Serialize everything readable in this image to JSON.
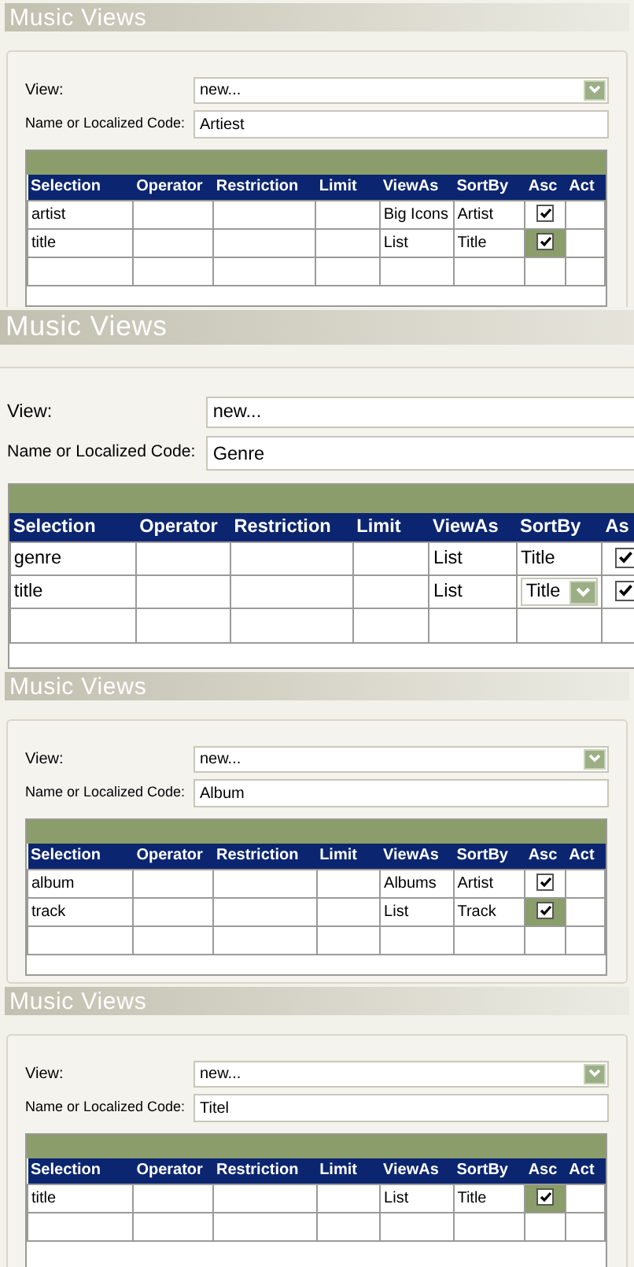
{
  "panels": [
    {
      "title": "Music Views",
      "view_label": "View:",
      "view_value": "new...",
      "name_label": "Name or Localized Code:",
      "name_value": "Artiest",
      "columns": [
        "Selection",
        "Operator",
        "Restriction",
        "Limit",
        "ViewAs",
        "SortBy",
        "Asc",
        "Act"
      ],
      "rows": [
        {
          "selection": "artist",
          "view_as": "Big Icons",
          "sort_by": "Artist",
          "sort_by_editing": false,
          "asc_checked": true,
          "asc_focused": false
        },
        {
          "selection": "title",
          "view_as": "List",
          "sort_by": "Title",
          "sort_by_editing": false,
          "asc_checked": true,
          "asc_focused": true
        }
      ]
    },
    {
      "title": "Music Views",
      "view_label": "View:",
      "view_value": "new...",
      "name_label": "Name or Localized Code:",
      "name_value": "Genre",
      "columns": [
        "Selection",
        "Operator",
        "Restriction",
        "Limit",
        "ViewAs",
        "SortBy",
        "As"
      ],
      "rows": [
        {
          "selection": "genre",
          "view_as": "List",
          "sort_by": "Title",
          "sort_by_editing": false,
          "asc_checked": true,
          "asc_focused": false
        },
        {
          "selection": "title",
          "view_as": "List",
          "sort_by": "Title",
          "sort_by_editing": true,
          "asc_checked": true,
          "asc_focused": false
        }
      ]
    },
    {
      "title": "Music Views",
      "view_label": "View:",
      "view_value": "new...",
      "name_label": "Name or Localized Code:",
      "name_value": "Album",
      "columns": [
        "Selection",
        "Operator",
        "Restriction",
        "Limit",
        "ViewAs",
        "SortBy",
        "Asc",
        "Act"
      ],
      "rows": [
        {
          "selection": "album",
          "view_as": "Albums",
          "sort_by": "Artist",
          "sort_by_editing": false,
          "asc_checked": true,
          "asc_focused": false
        },
        {
          "selection": "track",
          "view_as": "List",
          "sort_by": "Track",
          "sort_by_editing": false,
          "asc_checked": true,
          "asc_focused": true
        }
      ]
    },
    {
      "title": "Music Views",
      "view_label": "View:",
      "view_value": "new...",
      "name_label": "Name or Localized Code:",
      "name_value": "Titel",
      "columns": [
        "Selection",
        "Operator",
        "Restriction",
        "Limit",
        "ViewAs",
        "SortBy",
        "Asc",
        "Act"
      ],
      "rows": [
        {
          "selection": "title",
          "view_as": "List",
          "sort_by": "Title",
          "sort_by_editing": false,
          "asc_checked": true,
          "asc_focused": true
        }
      ]
    }
  ]
}
